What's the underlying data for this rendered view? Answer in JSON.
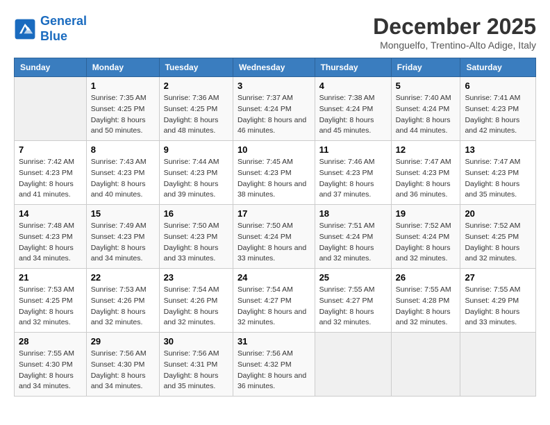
{
  "header": {
    "logo_line1": "General",
    "logo_line2": "Blue",
    "title": "December 2025",
    "subtitle": "Monguelfo, Trentino-Alto Adige, Italy"
  },
  "days_of_week": [
    "Sunday",
    "Monday",
    "Tuesday",
    "Wednesday",
    "Thursday",
    "Friday",
    "Saturday"
  ],
  "weeks": [
    [
      {
        "day": "",
        "sunrise": "",
        "sunset": "",
        "daylight": ""
      },
      {
        "day": "1",
        "sunrise": "Sunrise: 7:35 AM",
        "sunset": "Sunset: 4:25 PM",
        "daylight": "Daylight: 8 hours and 50 minutes."
      },
      {
        "day": "2",
        "sunrise": "Sunrise: 7:36 AM",
        "sunset": "Sunset: 4:25 PM",
        "daylight": "Daylight: 8 hours and 48 minutes."
      },
      {
        "day": "3",
        "sunrise": "Sunrise: 7:37 AM",
        "sunset": "Sunset: 4:24 PM",
        "daylight": "Daylight: 8 hours and 46 minutes."
      },
      {
        "day": "4",
        "sunrise": "Sunrise: 7:38 AM",
        "sunset": "Sunset: 4:24 PM",
        "daylight": "Daylight: 8 hours and 45 minutes."
      },
      {
        "day": "5",
        "sunrise": "Sunrise: 7:40 AM",
        "sunset": "Sunset: 4:24 PM",
        "daylight": "Daylight: 8 hours and 44 minutes."
      },
      {
        "day": "6",
        "sunrise": "Sunrise: 7:41 AM",
        "sunset": "Sunset: 4:23 PM",
        "daylight": "Daylight: 8 hours and 42 minutes."
      }
    ],
    [
      {
        "day": "7",
        "sunrise": "Sunrise: 7:42 AM",
        "sunset": "Sunset: 4:23 PM",
        "daylight": "Daylight: 8 hours and 41 minutes."
      },
      {
        "day": "8",
        "sunrise": "Sunrise: 7:43 AM",
        "sunset": "Sunset: 4:23 PM",
        "daylight": "Daylight: 8 hours and 40 minutes."
      },
      {
        "day": "9",
        "sunrise": "Sunrise: 7:44 AM",
        "sunset": "Sunset: 4:23 PM",
        "daylight": "Daylight: 8 hours and 39 minutes."
      },
      {
        "day": "10",
        "sunrise": "Sunrise: 7:45 AM",
        "sunset": "Sunset: 4:23 PM",
        "daylight": "Daylight: 8 hours and 38 minutes."
      },
      {
        "day": "11",
        "sunrise": "Sunrise: 7:46 AM",
        "sunset": "Sunset: 4:23 PM",
        "daylight": "Daylight: 8 hours and 37 minutes."
      },
      {
        "day": "12",
        "sunrise": "Sunrise: 7:47 AM",
        "sunset": "Sunset: 4:23 PM",
        "daylight": "Daylight: 8 hours and 36 minutes."
      },
      {
        "day": "13",
        "sunrise": "Sunrise: 7:47 AM",
        "sunset": "Sunset: 4:23 PM",
        "daylight": "Daylight: 8 hours and 35 minutes."
      }
    ],
    [
      {
        "day": "14",
        "sunrise": "Sunrise: 7:48 AM",
        "sunset": "Sunset: 4:23 PM",
        "daylight": "Daylight: 8 hours and 34 minutes."
      },
      {
        "day": "15",
        "sunrise": "Sunrise: 7:49 AM",
        "sunset": "Sunset: 4:23 PM",
        "daylight": "Daylight: 8 hours and 34 minutes."
      },
      {
        "day": "16",
        "sunrise": "Sunrise: 7:50 AM",
        "sunset": "Sunset: 4:23 PM",
        "daylight": "Daylight: 8 hours and 33 minutes."
      },
      {
        "day": "17",
        "sunrise": "Sunrise: 7:50 AM",
        "sunset": "Sunset: 4:24 PM",
        "daylight": "Daylight: 8 hours and 33 minutes."
      },
      {
        "day": "18",
        "sunrise": "Sunrise: 7:51 AM",
        "sunset": "Sunset: 4:24 PM",
        "daylight": "Daylight: 8 hours and 32 minutes."
      },
      {
        "day": "19",
        "sunrise": "Sunrise: 7:52 AM",
        "sunset": "Sunset: 4:24 PM",
        "daylight": "Daylight: 8 hours and 32 minutes."
      },
      {
        "day": "20",
        "sunrise": "Sunrise: 7:52 AM",
        "sunset": "Sunset: 4:25 PM",
        "daylight": "Daylight: 8 hours and 32 minutes."
      }
    ],
    [
      {
        "day": "21",
        "sunrise": "Sunrise: 7:53 AM",
        "sunset": "Sunset: 4:25 PM",
        "daylight": "Daylight: 8 hours and 32 minutes."
      },
      {
        "day": "22",
        "sunrise": "Sunrise: 7:53 AM",
        "sunset": "Sunset: 4:26 PM",
        "daylight": "Daylight: 8 hours and 32 minutes."
      },
      {
        "day": "23",
        "sunrise": "Sunrise: 7:54 AM",
        "sunset": "Sunset: 4:26 PM",
        "daylight": "Daylight: 8 hours and 32 minutes."
      },
      {
        "day": "24",
        "sunrise": "Sunrise: 7:54 AM",
        "sunset": "Sunset: 4:27 PM",
        "daylight": "Daylight: 8 hours and 32 minutes."
      },
      {
        "day": "25",
        "sunrise": "Sunrise: 7:55 AM",
        "sunset": "Sunset: 4:27 PM",
        "daylight": "Daylight: 8 hours and 32 minutes."
      },
      {
        "day": "26",
        "sunrise": "Sunrise: 7:55 AM",
        "sunset": "Sunset: 4:28 PM",
        "daylight": "Daylight: 8 hours and 32 minutes."
      },
      {
        "day": "27",
        "sunrise": "Sunrise: 7:55 AM",
        "sunset": "Sunset: 4:29 PM",
        "daylight": "Daylight: 8 hours and 33 minutes."
      }
    ],
    [
      {
        "day": "28",
        "sunrise": "Sunrise: 7:55 AM",
        "sunset": "Sunset: 4:30 PM",
        "daylight": "Daylight: 8 hours and 34 minutes."
      },
      {
        "day": "29",
        "sunrise": "Sunrise: 7:56 AM",
        "sunset": "Sunset: 4:30 PM",
        "daylight": "Daylight: 8 hours and 34 minutes."
      },
      {
        "day": "30",
        "sunrise": "Sunrise: 7:56 AM",
        "sunset": "Sunset: 4:31 PM",
        "daylight": "Daylight: 8 hours and 35 minutes."
      },
      {
        "day": "31",
        "sunrise": "Sunrise: 7:56 AM",
        "sunset": "Sunset: 4:32 PM",
        "daylight": "Daylight: 8 hours and 36 minutes."
      },
      {
        "day": "",
        "sunrise": "",
        "sunset": "",
        "daylight": ""
      },
      {
        "day": "",
        "sunrise": "",
        "sunset": "",
        "daylight": ""
      },
      {
        "day": "",
        "sunrise": "",
        "sunset": "",
        "daylight": ""
      }
    ]
  ]
}
